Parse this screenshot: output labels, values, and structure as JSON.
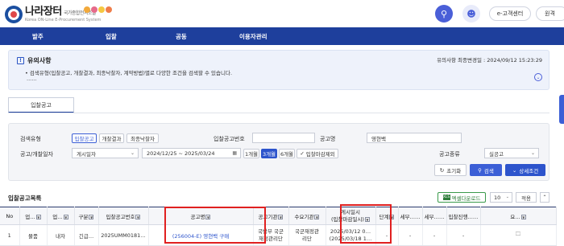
{
  "header": {
    "logo_main": "나라장터",
    "logo_agency": "국가종합전자조달",
    "logo_sub": "Korea ON-Line E-Procurement System",
    "search_icon": "search-icon",
    "user_icon": "user-icon",
    "customer_center": "e-고객센터",
    "more_label": "원격"
  },
  "nav": {
    "items": [
      "발주",
      "입찰",
      "공동",
      "이용자관리"
    ]
  },
  "notice": {
    "title": "유의사항",
    "updated": "유의사항 최종변경일 : 2024/09/12 15:23:29",
    "body": "• 검색유형(입찰공고, 개찰결과, 최종낙찰자, 계약방법)별로 다양한 조건을 검색할 수 있습니다.",
    "more": "......"
  },
  "tab": {
    "label": "입찰공고"
  },
  "search": {
    "type_label": "검색유형",
    "types": [
      "입찰공고",
      "개찰결과",
      "최종낙찰자"
    ],
    "notice_no_label": "입찰공고번호",
    "notice_no_value": "",
    "notice_name_label": "공고명",
    "notice_name_value": "영현백",
    "date_label": "공고/개찰일자",
    "date_type_value": "게시일자",
    "date_range": "2024/12/25 ~ 2025/03/24",
    "periods": [
      "1개월",
      "3개월",
      "6개월"
    ],
    "exclude_closed": "입찰마감제외",
    "kind_label": "공고종류",
    "kind_value": "실공고",
    "reset": "초기화",
    "search": "검색",
    "detail": "상세조건"
  },
  "results": {
    "title": "입찰공고목록",
    "excel": "엑셀다운로드",
    "page_size": "10",
    "apply": "적용",
    "columns": [
      "No",
      "업…",
      "업…",
      "구분",
      "입찰공고번호",
      "공고명",
      "공고기관",
      "수요기관",
      "게시일시\n(입찰마감일시)",
      "단계",
      "세부…",
      "세부…",
      "입찰진행…",
      "요…"
    ],
    "rows": [
      {
        "no": "1",
        "biz": "물품",
        "biz2": "내자",
        "kind": "긴급…",
        "notice_no": "2025UMM0181…",
        "title": "(256004-E) 영현백 구매",
        "org": "국방부 국군\n재정관리단",
        "demand": "국군재정관\n리단",
        "posted": "2025/03/12 0…\n(2025/03/18 1…",
        "stage": "-",
        "d1": "-",
        "d2": "-",
        "progress": "-"
      }
    ]
  }
}
